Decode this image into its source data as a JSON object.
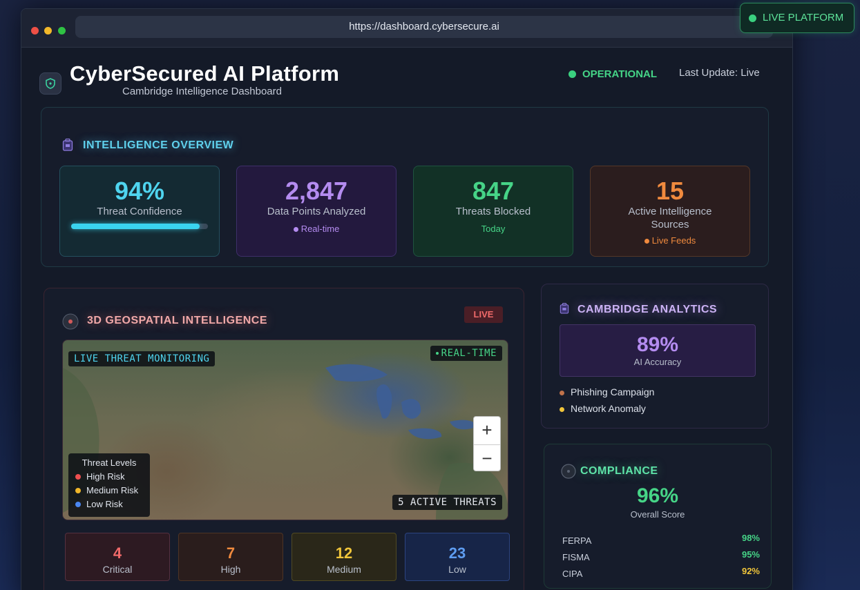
{
  "browser": {
    "url": "https://dashboard.cybersecure.ai",
    "live_platform_label": "LIVE PLATFORM"
  },
  "header": {
    "title": "CyberSecured AI Platform",
    "subtitle": "Cambridge Intelligence Dashboard",
    "status": "OPERATIONAL",
    "last_update": "Last Update: Live"
  },
  "overview": {
    "title": "INTELLIGENCE OVERVIEW",
    "metrics": [
      {
        "value": "94%",
        "label": "Threat Confidence",
        "progress": 0.94
      },
      {
        "value": "2,847",
        "label": "Data Points Analyzed",
        "sub": "Real-time"
      },
      {
        "value": "847",
        "label": "Threats Blocked",
        "sub": "Today"
      },
      {
        "value": "15",
        "label": "Active Intelligence Sources",
        "sub": "Live Feeds"
      }
    ]
  },
  "geo": {
    "title": "3D GEOSPATIAL INTELLIGENCE",
    "badge": "LIVE",
    "map_label_left": "LIVE THREAT MONITORING",
    "map_label_right": "REAL-TIME",
    "map_label_bottom": "5 ACTIVE THREATS",
    "zoom_in": "+",
    "zoom_out": "−",
    "legend": {
      "title": "Threat Levels",
      "items": [
        "High Risk",
        "Medium Risk",
        "Low Risk"
      ]
    },
    "counts": [
      {
        "value": "4",
        "label": "Critical"
      },
      {
        "value": "7",
        "label": "High"
      },
      {
        "value": "12",
        "label": "Medium"
      },
      {
        "value": "23",
        "label": "Low"
      }
    ]
  },
  "analytics": {
    "title": "CAMBRIDGE ANALYTICS",
    "accuracy_value": "89%",
    "accuracy_label": "AI Accuracy",
    "items": [
      "Phishing Campaign",
      "Network Anomaly"
    ]
  },
  "compliance": {
    "title": "COMPLIANCE",
    "score": "96%",
    "score_label": "Overall Score",
    "rows": [
      {
        "name": "FERPA",
        "value": "98%"
      },
      {
        "name": "FISMA",
        "value": "95%"
      },
      {
        "name": "CIPA",
        "value": "92%"
      }
    ]
  },
  "colors": {
    "accent_cyan": "#4fd4ef",
    "accent_purple": "#b48cf0",
    "accent_green": "#46d487",
    "accent_orange": "#f08a3e",
    "high_risk": "#ef4f4f",
    "medium_risk": "#f0b72a",
    "low_risk": "#4a86f0"
  }
}
